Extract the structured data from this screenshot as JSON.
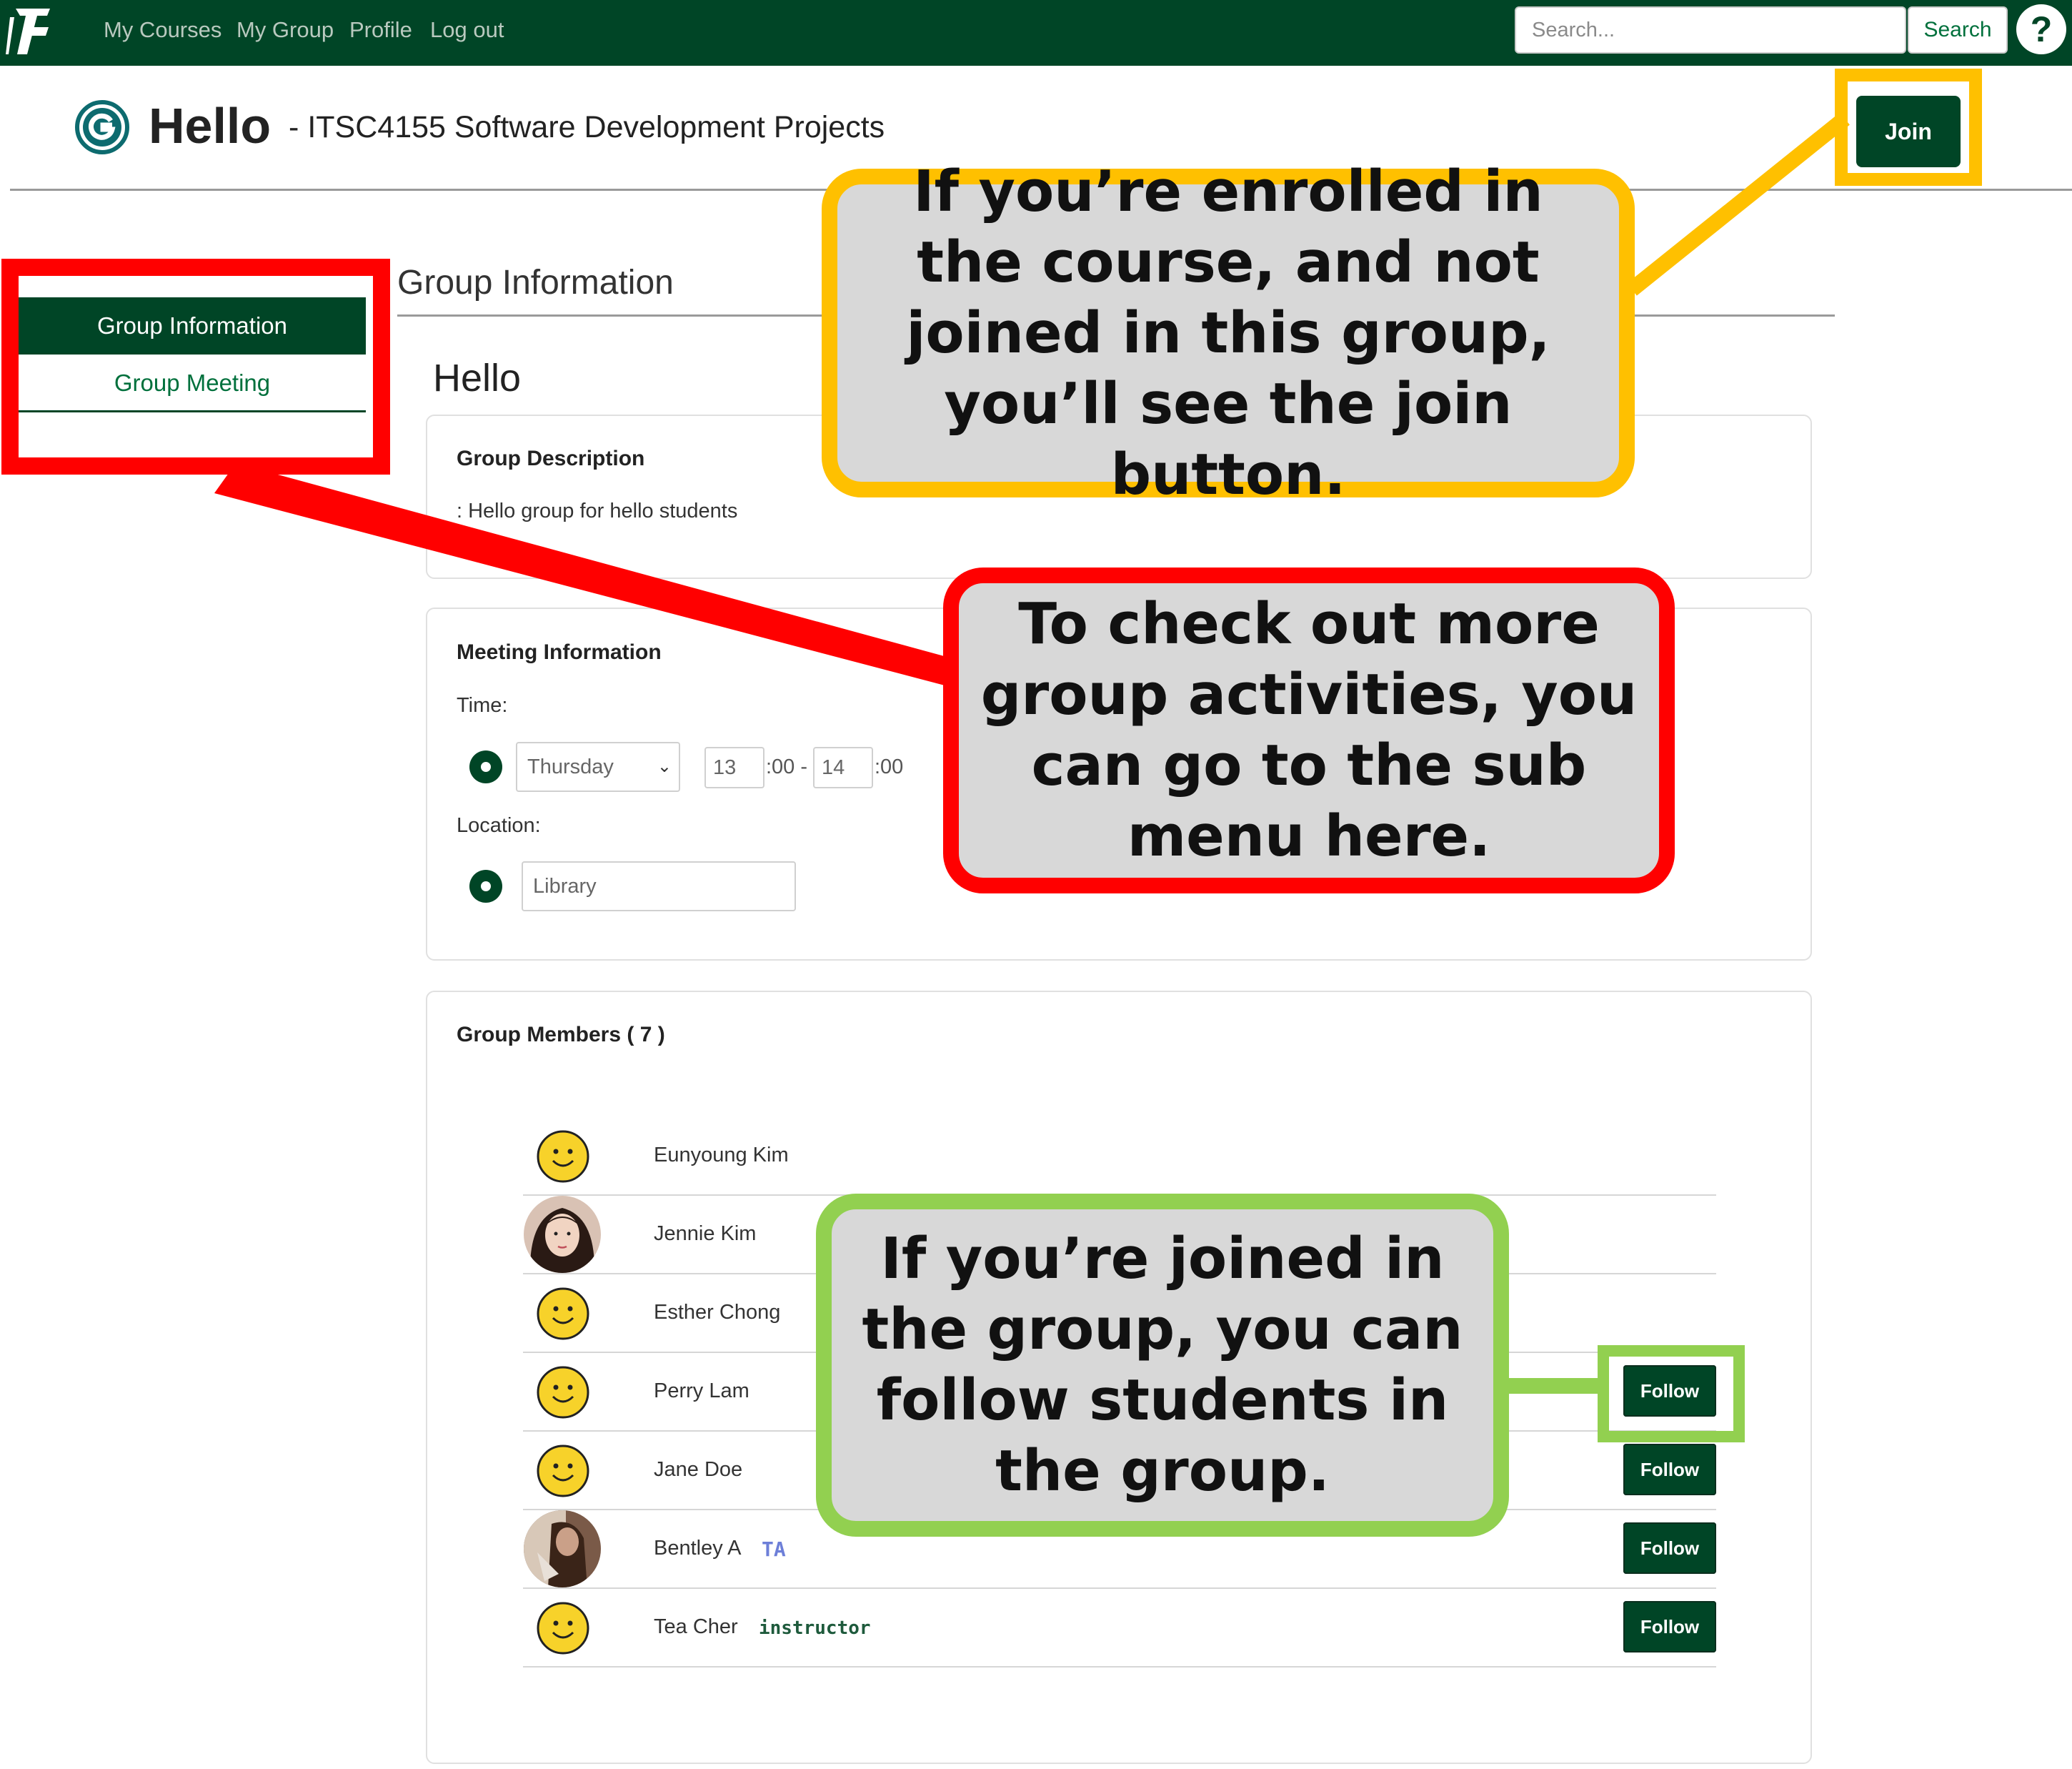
{
  "navbar": {
    "links": [
      "My Courses",
      "My Group",
      "Profile",
      "Log out"
    ],
    "search_placeholder": "Search...",
    "search_button": "Search",
    "help": "?"
  },
  "header": {
    "title": "Hello",
    "dash": "-",
    "course": "ITSC4155 Software Development Projects",
    "join_button": "Join"
  },
  "sidebar": {
    "items": [
      {
        "label": "Group Information",
        "active": true
      },
      {
        "label": "Group Meeting",
        "active": false
      }
    ]
  },
  "main": {
    "section_title": "Group Information",
    "group_name": "Hello",
    "description": {
      "title": "Group Description",
      "text": ": Hello group for hello students"
    },
    "meeting": {
      "title": "Meeting Information",
      "time_label": "Time:",
      "day": "Thursday",
      "start_hour": "13",
      "start_suffix": ":00 -",
      "end_hour": "14",
      "end_suffix": ":00",
      "location_label": "Location:",
      "location": "Library"
    },
    "members": {
      "title": "Group Members ( 7 )",
      "list": [
        {
          "name": "Eunyoung Kim",
          "avatar": "smiley-icon",
          "role": "",
          "follow": ""
        },
        {
          "name": "Jennie Kim",
          "avatar": "photo-avatar",
          "role": "",
          "follow": ""
        },
        {
          "name": "Esther Chong",
          "avatar": "smiley-icon",
          "role": "",
          "follow": ""
        },
        {
          "name": "Perry Lam",
          "avatar": "smiley-icon",
          "role": "",
          "follow": "Follow"
        },
        {
          "name": "Jane Doe",
          "avatar": "smiley-icon",
          "role": "",
          "follow": "Follow"
        },
        {
          "name": "Bentley A",
          "avatar": "photo-avatar",
          "role": "TA",
          "follow": "Follow"
        },
        {
          "name": "Tea Cher",
          "avatar": "smiley-icon",
          "role": "instructor",
          "follow": "Follow"
        }
      ]
    }
  },
  "annotations": {
    "join": "If you’re enrolled in the course, and not joined in this group, you’ll see the join button.",
    "menu": "To check out more group activities, you can go to the sub menu here.",
    "follow": "If you’re joined in the group, you can follow students in the group."
  },
  "colors": {
    "brand_green": "#004526",
    "accent_green": "#00703c",
    "callout_yellow": "#ffc000",
    "callout_red": "#ff0000",
    "callout_green": "#92d050",
    "callout_fill": "#d8d8d8",
    "ta_badge": "#6d7fd8",
    "instructor_badge": "#1e5a3c"
  }
}
